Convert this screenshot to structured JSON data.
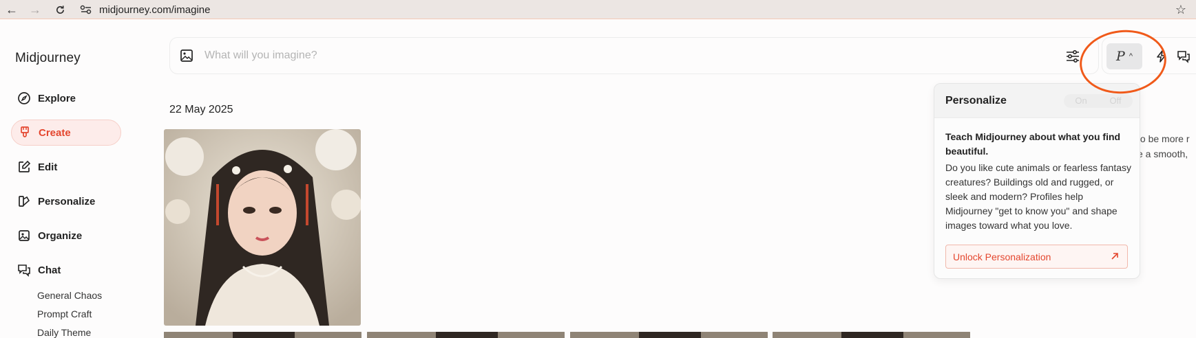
{
  "browser": {
    "url": "midjourney.com/imagine",
    "back_icon": "back-arrow-icon",
    "forward_icon": "forward-arrow-icon",
    "reload_icon": "reload-icon",
    "bookmark_icon": "star-icon"
  },
  "sidebar": {
    "brand": "Midjourney",
    "items": [
      {
        "label": "Explore",
        "icon": "compass-icon"
      },
      {
        "label": "Create",
        "icon": "brush-icon",
        "active": true
      },
      {
        "label": "Edit",
        "icon": "edit-icon"
      },
      {
        "label": "Personalize",
        "icon": "personalize-icon"
      },
      {
        "label": "Organize",
        "icon": "image-icon"
      },
      {
        "label": "Chat",
        "icon": "chat-icon"
      }
    ],
    "chat_rooms": [
      "General Chaos",
      "Prompt Craft",
      "Daily Theme"
    ]
  },
  "prompt": {
    "placeholder": "What will you imagine?",
    "personalize_label": "P"
  },
  "feed": {
    "date": "22 May 2025",
    "side_text": [
      "to be more r",
      "e a smooth, "
    ]
  },
  "popover": {
    "title": "Personalize",
    "toggle_on": "On",
    "toggle_off": "Off",
    "lead": "Teach Midjourney about what you find beautiful.",
    "body": "Do you like cute animals or fearless fantasy creatures? Buildings old and rugged, or sleek and modern? Profiles help Midjourney \"get to know you\" and shape images toward what you love.",
    "cta": "Unlock Personalization"
  },
  "colors": {
    "accent": "#e4462e",
    "annotation": "#f05a1a"
  }
}
